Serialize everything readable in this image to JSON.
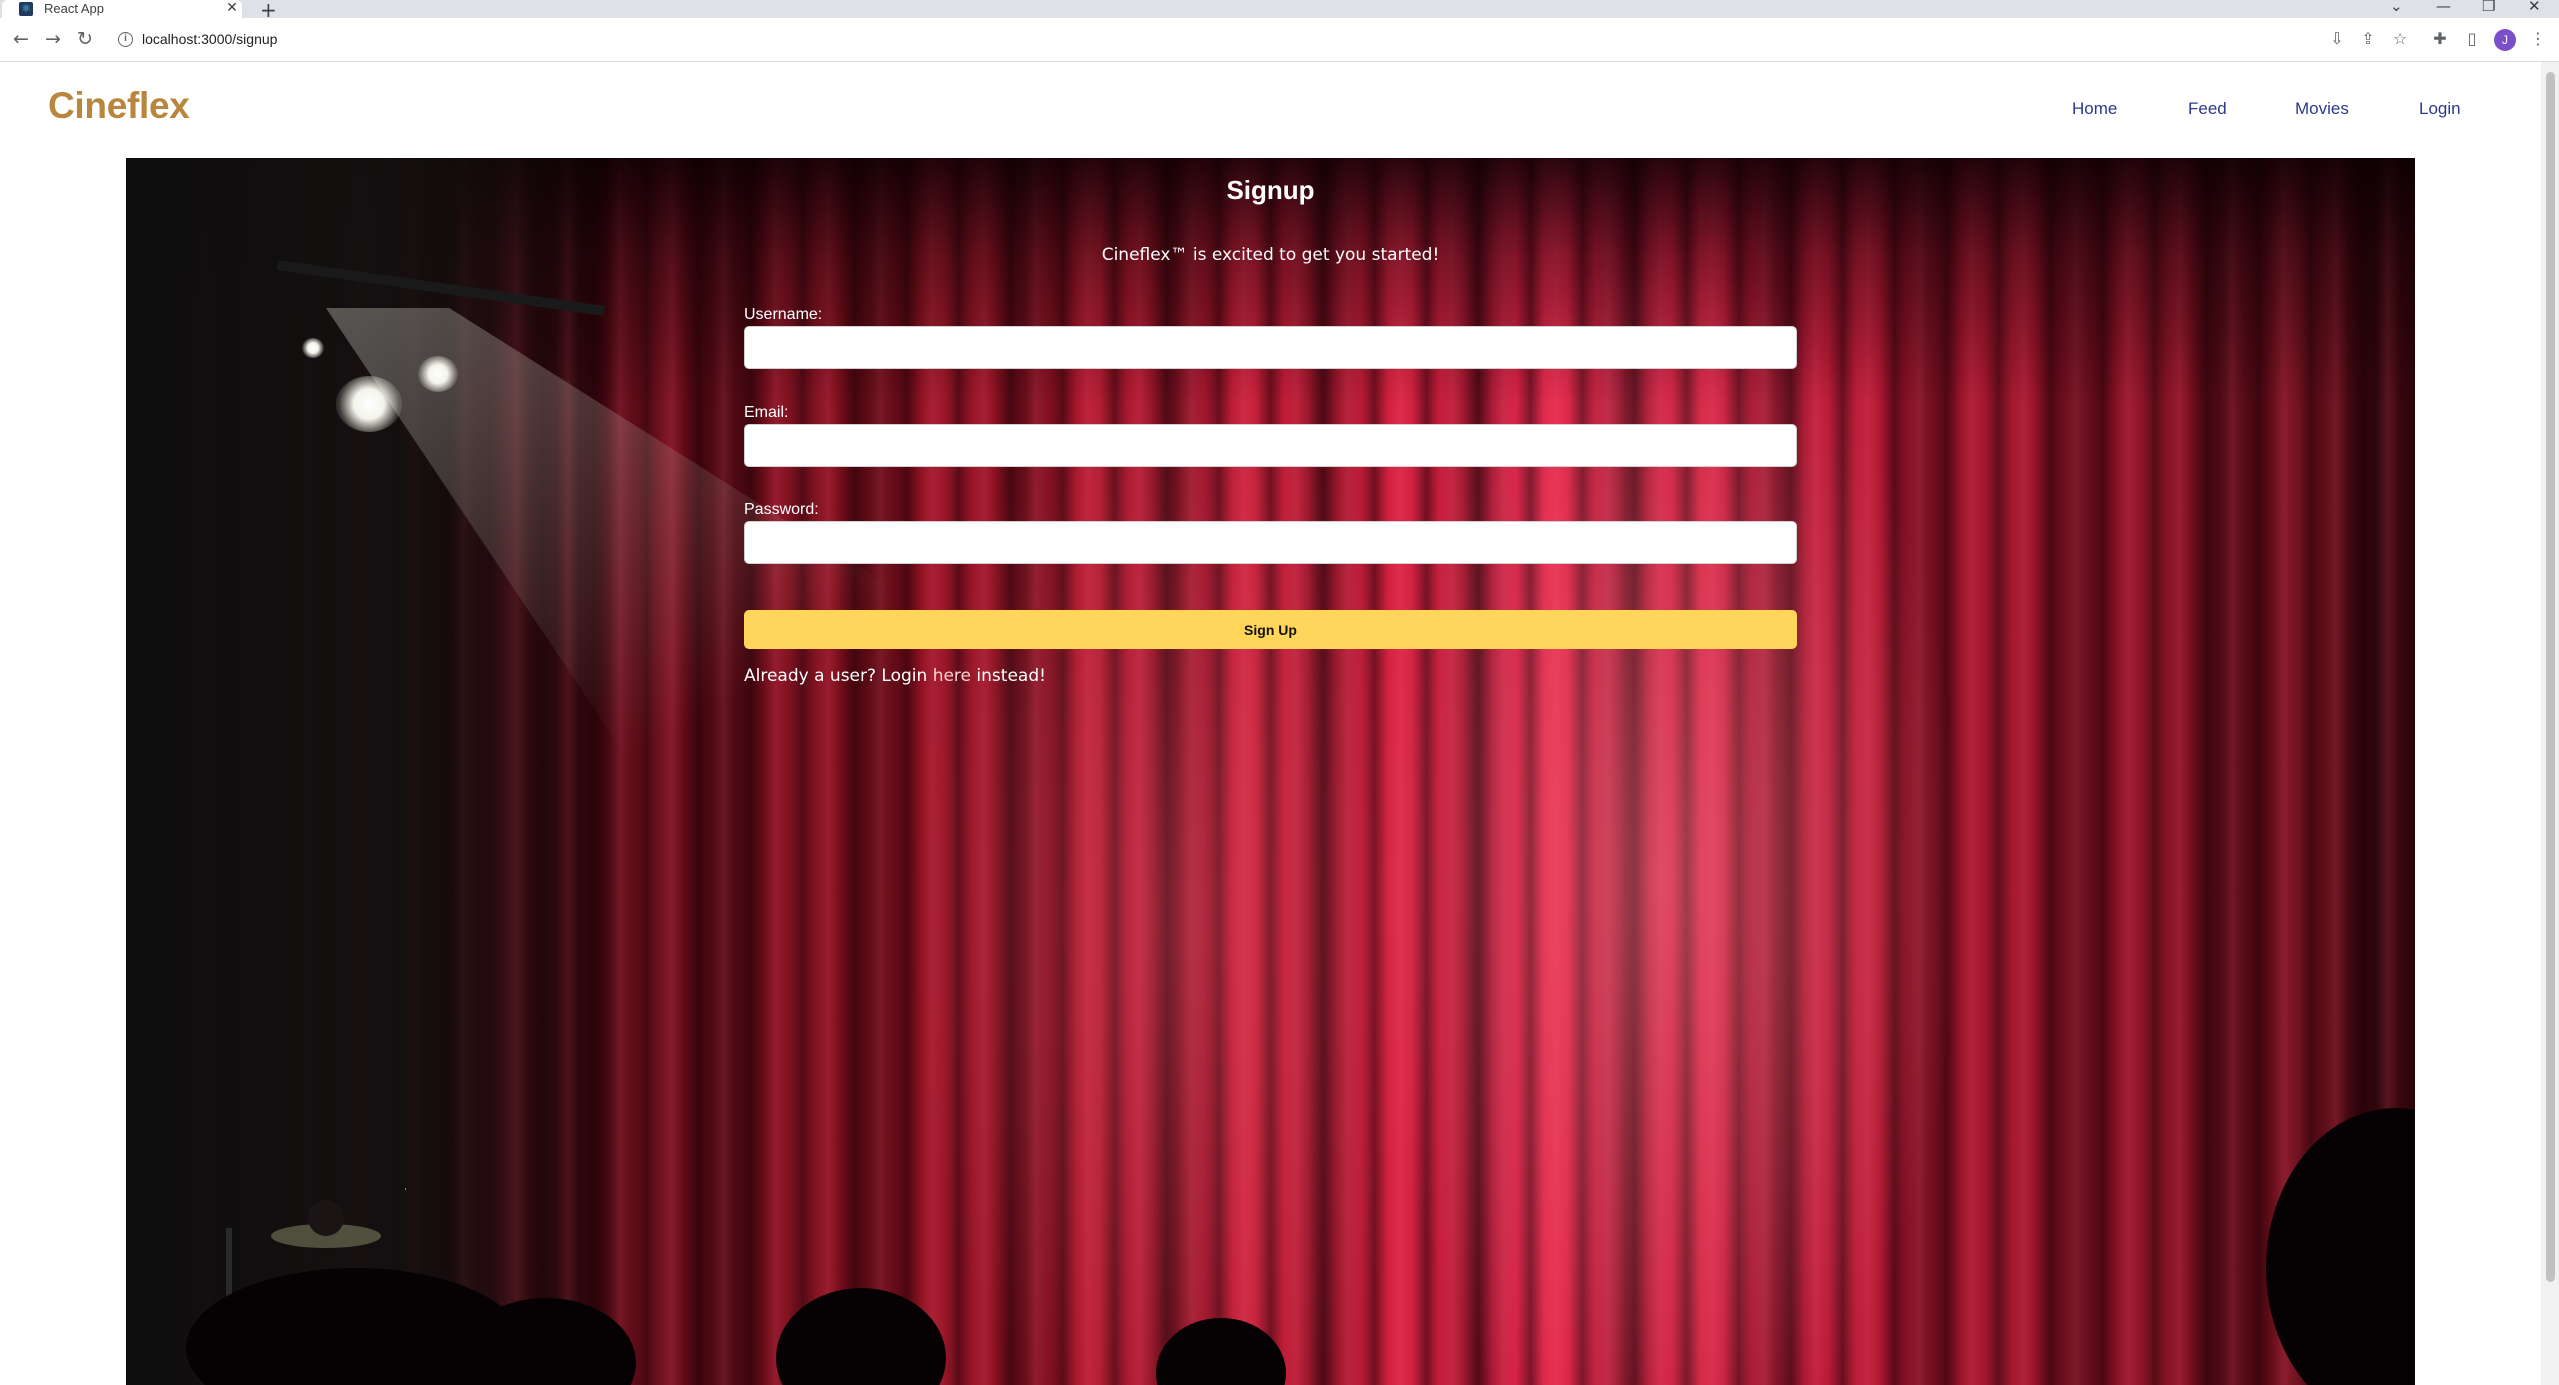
{
  "browser": {
    "tab_title": "React App",
    "tab_close": "✕",
    "new_tab": "+",
    "url": "localhost:3000/signup",
    "window_controls": [
      "⌄",
      "—",
      "❐",
      "✕"
    ]
  },
  "navbar": {
    "brand": "Cineflex",
    "links": [
      "Home",
      "Feed",
      "Movies",
      "Login"
    ]
  },
  "signup": {
    "title": "Signup",
    "subtitle": "Cineflex™ is excited to get you started!",
    "fields": [
      {
        "label": "Username:",
        "value": "",
        "placeholder": ""
      },
      {
        "label": "Email:",
        "value": "",
        "placeholder": ""
      },
      {
        "label": "Password:",
        "value": "",
        "placeholder": ""
      }
    ],
    "button_label": "Sign Up",
    "login_prompt_before": "Already a user? Login ",
    "login_link": "here",
    "login_prompt_after": " instead!"
  },
  "icons": {
    "back": "back-arrow-icon",
    "forward": "forward-arrow-icon",
    "reload": "reload-icon",
    "site_info": "info-icon",
    "install": "install-app-icon",
    "share": "share-icon",
    "bookmark": "star-icon",
    "extensions": "puzzle-icon",
    "side_panel": "side-panel-icon",
    "menu": "kebab-menu-icon"
  },
  "profile": {
    "initial": "J",
    "color": "#7b4fc9"
  },
  "colors": {
    "brand": "#b8863c",
    "nav_link": "#2b3a8a",
    "button": "#ffd65a"
  }
}
